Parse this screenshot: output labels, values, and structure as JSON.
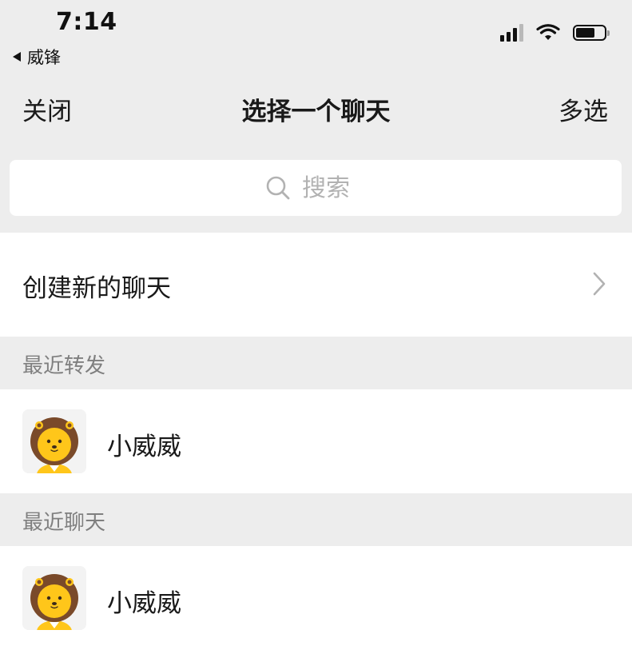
{
  "status_bar": {
    "time": "7:14",
    "back_app": "威锋",
    "icons": [
      "signal-icon",
      "wifi-icon",
      "battery-icon"
    ]
  },
  "nav": {
    "left": "关闭",
    "title": "选择一个聊天",
    "right": "多选"
  },
  "search": {
    "placeholder": "搜索",
    "icon": "search-icon"
  },
  "create_chat": {
    "label": "创建新的聊天",
    "icon": "chevron-right-icon"
  },
  "sections": [
    {
      "title": "最近转发",
      "items": [
        {
          "name": "小威威",
          "avatar": "lion-avatar-icon"
        }
      ]
    },
    {
      "title": "最近聊天",
      "items": [
        {
          "name": "小威威",
          "avatar": "lion-avatar-icon"
        }
      ]
    }
  ],
  "colors": {
    "background": "#ededed",
    "row_background": "#ffffff",
    "text_primary": "#191919",
    "text_secondary": "#7f7f7f",
    "placeholder": "#b2b2b2",
    "lion_mane": "#7a4a2a",
    "lion_face": "#ffc61a"
  }
}
